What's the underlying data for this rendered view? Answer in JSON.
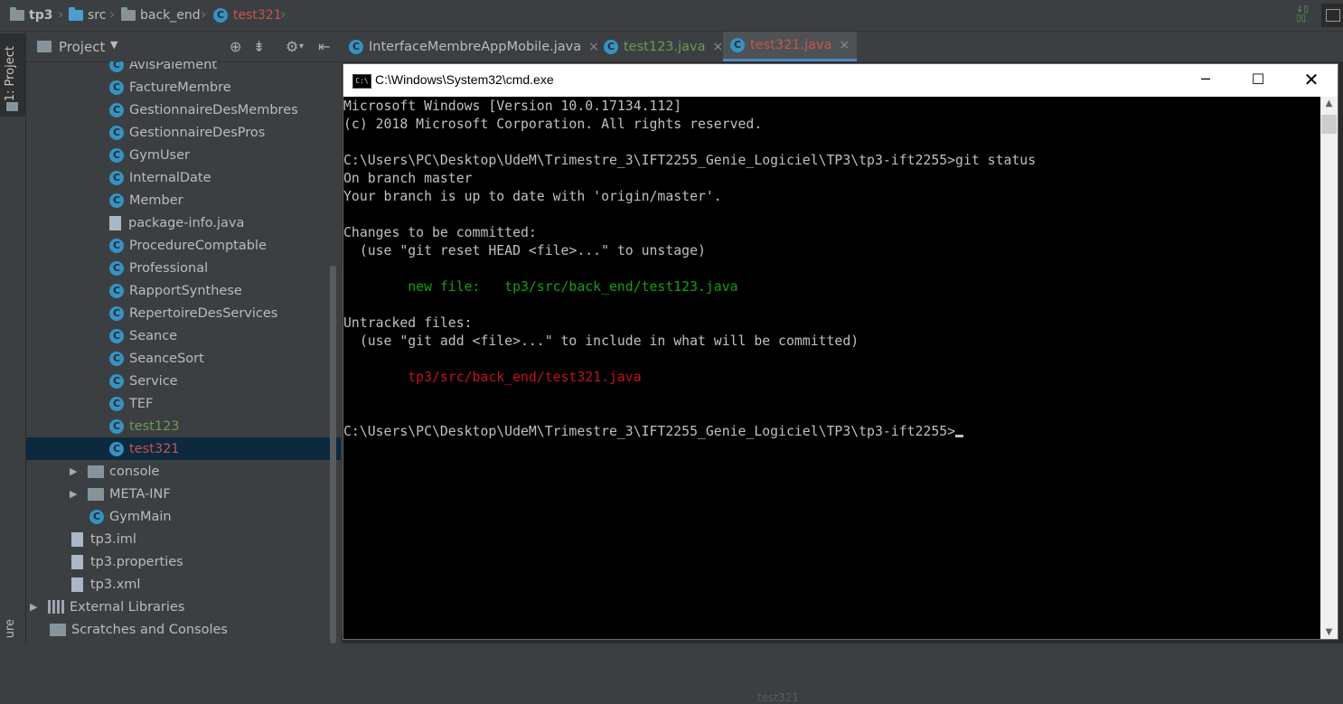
{
  "breadcrumb": {
    "project": "tp3",
    "src": "src",
    "package": "back_end",
    "file": "test321"
  },
  "leftstrip": {
    "project_tab": "1: Project",
    "bottom_tab": "ure"
  },
  "project_panel": {
    "title": "Project",
    "tree": [
      {
        "label": "AvisPaiement",
        "kind": "class"
      },
      {
        "label": "FactureMembre",
        "kind": "class"
      },
      {
        "label": "GestionnaireDesMembres",
        "kind": "class"
      },
      {
        "label": "GestionnaireDesPros",
        "kind": "class"
      },
      {
        "label": "GymUser",
        "kind": "class"
      },
      {
        "label": "InternalDate",
        "kind": "class"
      },
      {
        "label": "Member",
        "kind": "class"
      },
      {
        "label": "package-info.java",
        "kind": "file"
      },
      {
        "label": "ProcedureComptable",
        "kind": "class"
      },
      {
        "label": "Professional",
        "kind": "class"
      },
      {
        "label": "RapportSynthese",
        "kind": "class"
      },
      {
        "label": "RepertoireDesServices",
        "kind": "class"
      },
      {
        "label": "Seance",
        "kind": "class"
      },
      {
        "label": "SeanceSort",
        "kind": "class"
      },
      {
        "label": "Service",
        "kind": "class"
      },
      {
        "label": "TEF",
        "kind": "class"
      },
      {
        "label": "test123",
        "kind": "class-green"
      },
      {
        "label": "test321",
        "kind": "class-red",
        "selected": true
      },
      {
        "label": "console",
        "kind": "folder"
      },
      {
        "label": "META-INF",
        "kind": "folder"
      },
      {
        "label": "GymMain",
        "kind": "class-main"
      },
      {
        "label": "tp3.iml",
        "kind": "file"
      },
      {
        "label": "tp3.properties",
        "kind": "file"
      },
      {
        "label": "tp3.xml",
        "kind": "file"
      },
      {
        "label": "External Libraries",
        "kind": "library"
      },
      {
        "label": "Scratches and Consoles",
        "kind": "scratch"
      }
    ]
  },
  "tabs": [
    {
      "label": "InterfaceMembreAppMobile.java"
    },
    {
      "label": "test123.java"
    },
    {
      "label": "test321.java"
    }
  ],
  "cmd": {
    "title": "C:\\Windows\\System32\\cmd.exe",
    "lines": [
      "Microsoft Windows [Version 10.0.17134.112]",
      "(c) 2018 Microsoft Corporation. All rights reserved.",
      "C:\\Users\\PC\\Desktop\\UdeM\\Trimestre_3\\IFT2255_Genie_Logiciel\\TP3\\tp3-ift2255>git status",
      "On branch master",
      "Your branch is up to date with 'origin/master'.",
      "Changes to be committed:",
      "  (use \"git reset HEAD <file>...\" to unstage)",
      "        new file:   tp3/src/back_end/test123.java",
      "Untracked files:",
      "  (use \"git add <file>...\" to include in what will be committed)",
      "        tp3/src/back_end/test321.java",
      "C:\\Users\\PC\\Desktop\\UdeM\\Trimestre_3\\IFT2255_Genie_Logiciel\\TP3\\tp3-ift2255>"
    ]
  },
  "editor_peek": "test321"
}
